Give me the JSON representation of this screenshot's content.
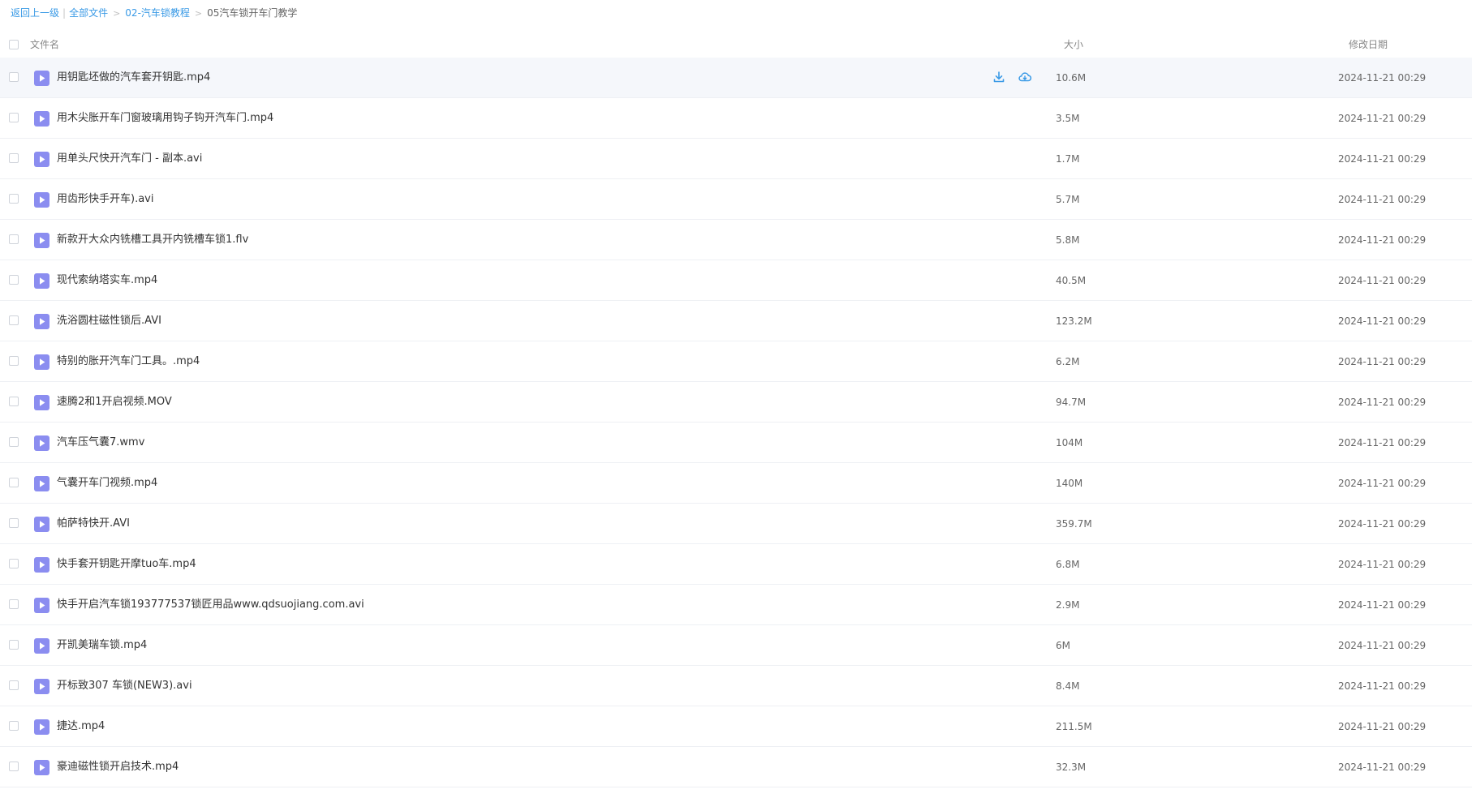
{
  "breadcrumb": {
    "back": "返回上一级",
    "separator": "|",
    "all_files": "全部文件",
    "parent": "02-汽车锁教程",
    "current": "05汽车锁开车门教学",
    "arrow": ">"
  },
  "header": {
    "name": "文件名",
    "size": "大小",
    "modified": "修改日期"
  },
  "colors": {
    "accent": "#3a9ae6",
    "video_icon": "#8b8df0"
  },
  "files": [
    {
      "name": "用钥匙坯做的汽车套开钥匙.mp4",
      "size": "10.6M",
      "date": "2024-11-21 00:29",
      "icon": "video-file-icon"
    },
    {
      "name": "用木尖胀开车门窗玻璃用钩子钩开汽车门.mp4",
      "size": "3.5M",
      "date": "2024-11-21 00:29",
      "icon": "video-file-icon"
    },
    {
      "name": "用单头尺快开汽车门 - 副本.avi",
      "size": "1.7M",
      "date": "2024-11-21 00:29",
      "icon": "video-file-icon"
    },
    {
      "name": "用齿形快手开车).avi",
      "size": "5.7M",
      "date": "2024-11-21 00:29",
      "icon": "video-file-icon"
    },
    {
      "name": "新款开大众内铣槽工具开内铣槽车锁1.flv",
      "size": "5.8M",
      "date": "2024-11-21 00:29",
      "icon": "video-file-icon"
    },
    {
      "name": "现代索纳塔实车.mp4",
      "size": "40.5M",
      "date": "2024-11-21 00:29",
      "icon": "video-file-icon"
    },
    {
      "name": "洗浴圆柱磁性锁后.AVI",
      "size": "123.2M",
      "date": "2024-11-21 00:29",
      "icon": "video-file-icon"
    },
    {
      "name": "特别的胀开汽车门工具。.mp4",
      "size": "6.2M",
      "date": "2024-11-21 00:29",
      "icon": "video-file-icon"
    },
    {
      "name": "速腾2和1开启视频.MOV",
      "size": "94.7M",
      "date": "2024-11-21 00:29",
      "icon": "video-file-icon"
    },
    {
      "name": "汽车压气囊7.wmv",
      "size": "104M",
      "date": "2024-11-21 00:29",
      "icon": "video-file-icon"
    },
    {
      "name": "气囊开车门视频.mp4",
      "size": "140M",
      "date": "2024-11-21 00:29",
      "icon": "video-file-icon"
    },
    {
      "name": "帕萨特快开.AVI",
      "size": "359.7M",
      "date": "2024-11-21 00:29",
      "icon": "video-file-icon"
    },
    {
      "name": "快手套开钥匙开摩tuo车.mp4",
      "size": "6.8M",
      "date": "2024-11-21 00:29",
      "icon": "video-file-icon"
    },
    {
      "name": "快手开启汽车锁193777537锁匠用品www.qdsuojiang.com.avi",
      "size": "2.9M",
      "date": "2024-11-21 00:29",
      "icon": "video-file-icon"
    },
    {
      "name": "开凯美瑞车锁.mp4",
      "size": "6M",
      "date": "2024-11-21 00:29",
      "icon": "video-file-icon"
    },
    {
      "name": "开标致307 车锁(NEW3).avi",
      "size": "8.4M",
      "date": "2024-11-21 00:29",
      "icon": "video-file-icon"
    },
    {
      "name": "捷达.mp4",
      "size": "211.5M",
      "date": "2024-11-21 00:29",
      "icon": "video-file-icon"
    },
    {
      "name": "豪迪磁性锁开启技术.mp4",
      "size": "32.3M",
      "date": "2024-11-21 00:29",
      "icon": "video-file-icon"
    }
  ],
  "row_actions": {
    "download_icon": "download-icon",
    "cloud_save_icon": "cloud-save-icon"
  }
}
